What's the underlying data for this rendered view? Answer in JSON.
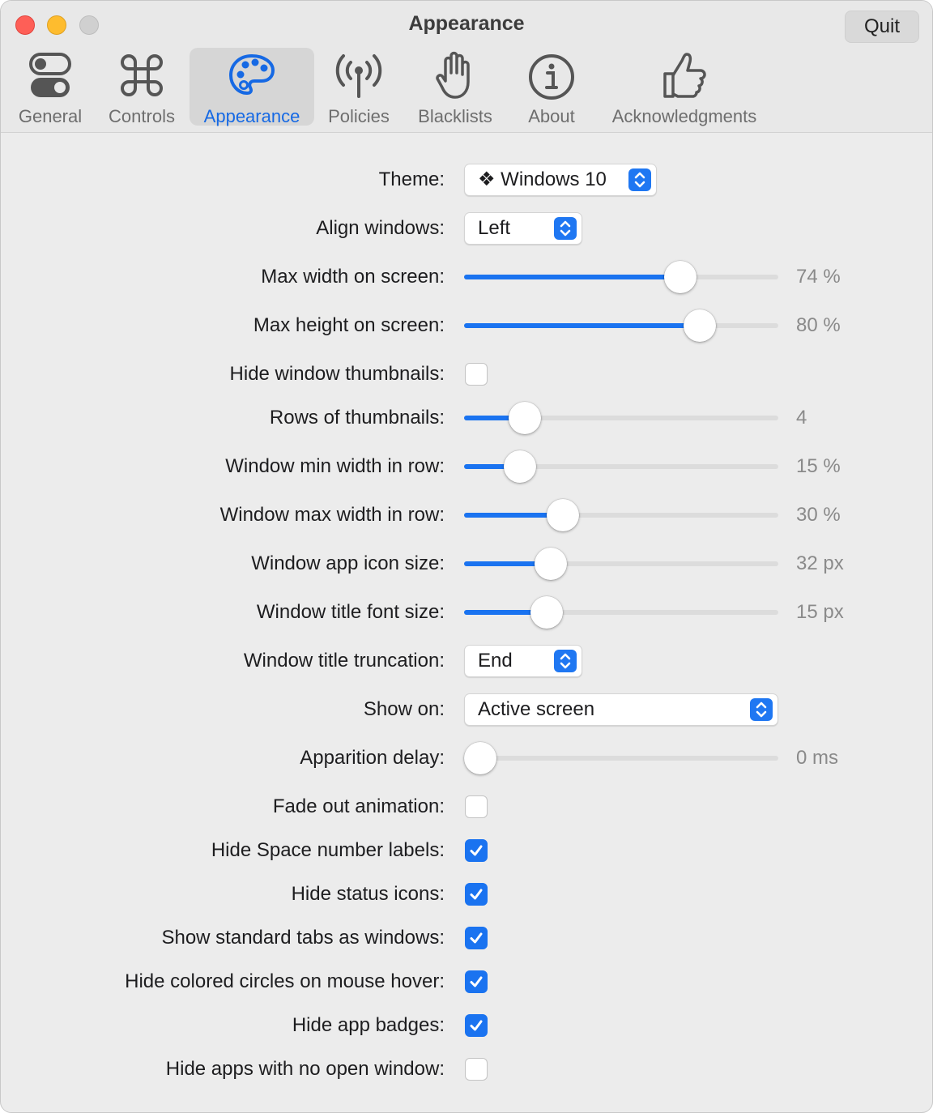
{
  "window": {
    "title": "Appearance",
    "quit_label": "Quit"
  },
  "tabs": [
    {
      "label": "General",
      "icon": "toggle-switches-icon"
    },
    {
      "label": "Controls",
      "icon": "command-key-icon"
    },
    {
      "label": "Appearance",
      "icon": "palette-icon",
      "selected": true
    },
    {
      "label": "Policies",
      "icon": "antenna-icon"
    },
    {
      "label": "Blacklists",
      "icon": "raised-hand-icon"
    },
    {
      "label": "About",
      "icon": "info-circle-icon"
    },
    {
      "label": "Acknowledgments",
      "icon": "thumbs-up-icon"
    }
  ],
  "settings": {
    "theme": {
      "label": "Theme:",
      "value": "❖ Windows 10"
    },
    "align_windows": {
      "label": "Align windows:",
      "value": "Left"
    },
    "max_width": {
      "label": "Max width on screen:",
      "value": 74,
      "min": 10,
      "max": 100,
      "display": "74 %"
    },
    "max_height": {
      "label": "Max height on screen:",
      "value": 80,
      "min": 10,
      "max": 100,
      "display": "80 %"
    },
    "hide_thumbnails": {
      "label": "Hide window thumbnails:",
      "checked": false
    },
    "rows_thumbnails": {
      "label": "Rows of thumbnails:",
      "value": 4,
      "min": 1,
      "max": 20,
      "display": "4"
    },
    "min_width_row": {
      "label": "Window min width in row:",
      "value": 15,
      "min": 1,
      "max": 100,
      "display": "15 %"
    },
    "max_width_row": {
      "label": "Window max width in row:",
      "value": 30,
      "min": 1,
      "max": 100,
      "display": "30 %"
    },
    "icon_size": {
      "label": "Window app icon size:",
      "value": 32,
      "min": 0,
      "max": 128,
      "display": "32 px"
    },
    "title_font_size": {
      "label": "Window title font size:",
      "value": 15,
      "min": 0,
      "max": 64,
      "display": "15 px"
    },
    "title_truncation": {
      "label": "Window title truncation:",
      "value": "End"
    },
    "show_on": {
      "label": "Show on:",
      "value": "Active screen"
    },
    "apparition_delay": {
      "label": "Apparition delay:",
      "value": 0,
      "min": 0,
      "max": 2000,
      "display": "0 ms"
    },
    "fade_out": {
      "label": "Fade out animation:",
      "checked": false
    },
    "hide_space_labels": {
      "label": "Hide Space number labels:",
      "checked": true
    },
    "hide_status_icons": {
      "label": "Hide status icons:",
      "checked": true
    },
    "standard_tabs": {
      "label": "Show standard tabs as windows:",
      "checked": true
    },
    "hide_colored_circles": {
      "label": "Hide colored circles on mouse hover:",
      "checked": true
    },
    "hide_app_badges": {
      "label": "Hide app badges:",
      "checked": true
    },
    "hide_apps_no_window": {
      "label": "Hide apps with no open window:",
      "checked": false
    }
  },
  "colors": {
    "accent": "#1a73f0",
    "selected_tab_text": "#1669e4"
  }
}
